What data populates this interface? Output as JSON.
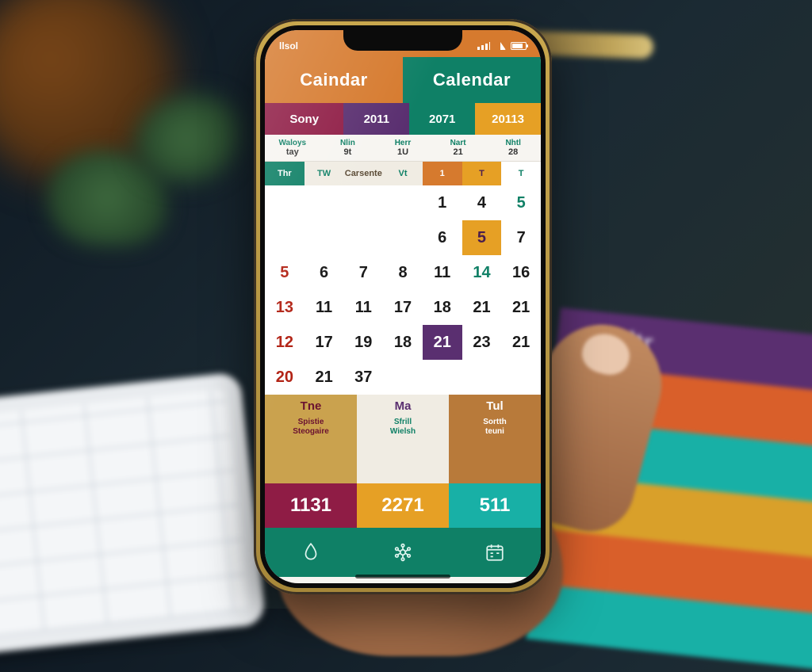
{
  "status": {
    "time": "llsol"
  },
  "header": {
    "left": "Caindar",
    "right": "Calendar"
  },
  "subheader": [
    "Sony",
    "2011",
    "2071",
    "20113"
  ],
  "minirow": [
    {
      "top": "Waloys",
      "bot": "tay"
    },
    {
      "top": "Nlin",
      "bot": "9t"
    },
    {
      "top": "Herr",
      "bot": "1U"
    },
    {
      "top": "Nart",
      "bot": "21"
    },
    {
      "top": "Nhtl",
      "bot": "28"
    }
  ],
  "weekhdr": [
    "Thr",
    "TW",
    "Carsente",
    "Vt",
    "1",
    "T",
    "T"
  ],
  "grid": [
    [
      "",
      "",
      "",
      "",
      "1",
      "4",
      "5"
    ],
    [
      "",
      "",
      "",
      "",
      "6",
      "5",
      "7"
    ],
    [
      "5",
      "6",
      "7",
      "8",
      "11",
      "14",
      "16"
    ],
    [
      "13",
      "11",
      "11",
      "17",
      "18",
      "21",
      "21"
    ],
    [
      "12",
      "17",
      "19",
      "18",
      "21",
      "23",
      "21"
    ],
    [
      "20",
      "21",
      "37",
      "",
      "",
      "",
      ""
    ]
  ],
  "grid_styles": [
    [
      "empty",
      "empty",
      "empty",
      "empty",
      "",
      "",
      "teal"
    ],
    [
      "empty",
      "empty",
      "empty",
      "empty",
      "",
      "gold",
      ""
    ],
    [
      "red",
      "",
      "",
      "",
      "",
      "teal",
      ""
    ],
    [
      "red",
      "",
      "",
      "",
      "",
      "",
      ""
    ],
    [
      "red",
      "",
      "",
      "",
      "purple",
      "",
      ""
    ],
    [
      "red",
      "",
      "",
      "empty",
      "empty",
      "empty",
      "empty"
    ]
  ],
  "dayband": [
    {
      "lbl": "Tne",
      "sub1": "Spistie",
      "sub2": "Steogaire"
    },
    {
      "lbl": "Ma",
      "sub1": "Sfrill",
      "sub2": "Wielsh"
    },
    {
      "lbl": "Tul",
      "sub1": "Sortth",
      "sub2": "teuni"
    }
  ],
  "numband": [
    "1131",
    "2271",
    "511"
  ],
  "paper_label": "Cultr",
  "colors": {
    "orange": "#d67a2e",
    "teal": "#0f8066",
    "cyan": "#18b0a6",
    "gold": "#e6a025",
    "maroon": "#8f1c45",
    "purple": "#5a2f70"
  }
}
